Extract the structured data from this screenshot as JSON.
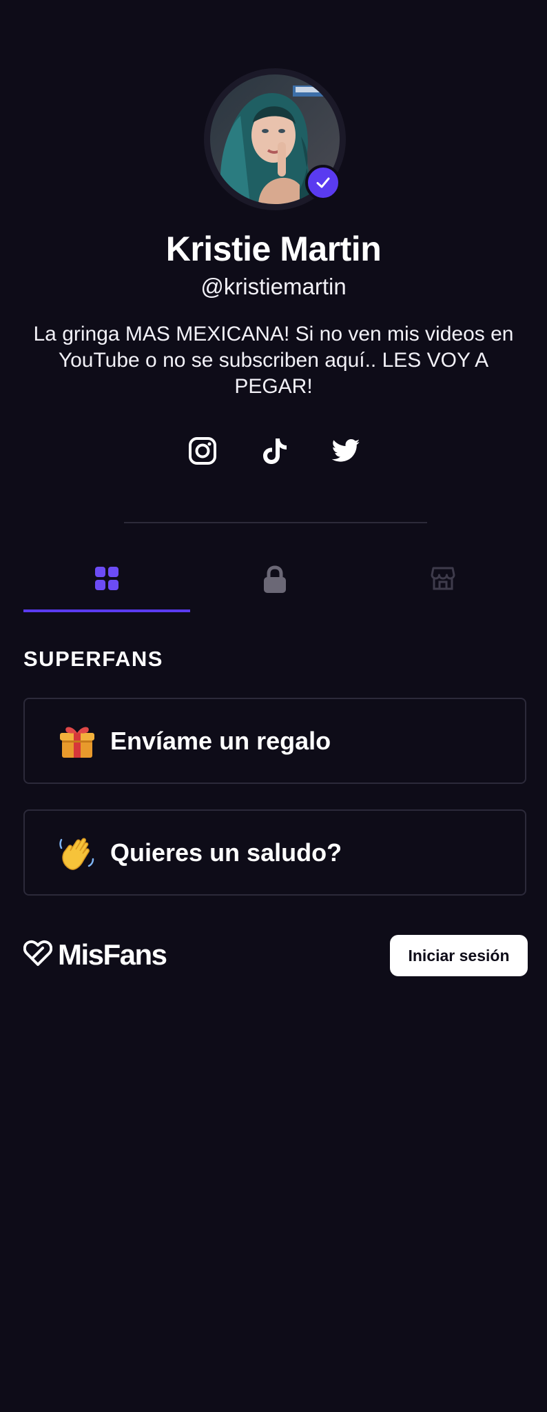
{
  "profile": {
    "name": "Kristie Martin",
    "handle": "@kristiemartin",
    "bio": "La gringa MAS MEXICANA! Si no ven mis videos en YouTube o no se subscriben aquí.. LES VOY A PEGAR!",
    "verified": true
  },
  "socials": [
    {
      "icon": "instagram-icon"
    },
    {
      "icon": "tiktok-icon"
    },
    {
      "icon": "twitter-icon"
    }
  ],
  "tabs": [
    {
      "icon": "grid-icon",
      "active": true
    },
    {
      "icon": "lock-icon",
      "active": false
    },
    {
      "icon": "store-icon",
      "active": false
    }
  ],
  "section": {
    "title": "SUPERFANS",
    "cards": [
      {
        "emoji": "gift-icon",
        "label": "Envíame un regalo"
      },
      {
        "emoji": "waving-hand-icon",
        "label": "Quieres un saludo?"
      }
    ]
  },
  "footer": {
    "brand": "MisFans",
    "login_label": "Iniciar sesión"
  },
  "colors": {
    "background": "#0e0c18",
    "accent": "#5a3bf0",
    "border": "#2c2a3a",
    "inactive_icon": "#6b6876",
    "muted_icon": "#3e3b4b"
  }
}
